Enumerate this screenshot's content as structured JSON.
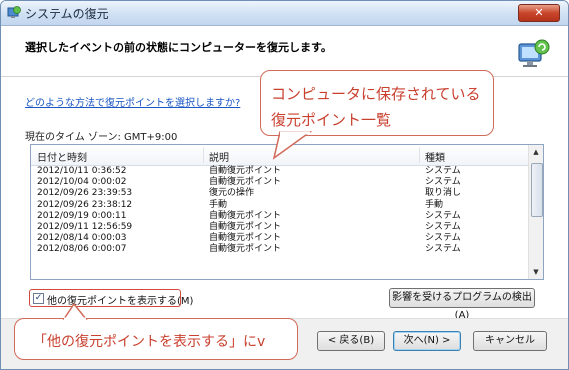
{
  "window": {
    "title": "システムの復元",
    "close_label": "✕"
  },
  "header": {
    "heading": "選択したイベントの前の状態にコンピューターを復元します。"
  },
  "body": {
    "link": "どのような方法で復元ポイントを選択しますか?",
    "timezone": "現在のタイム ゾーン: GMT+9:00"
  },
  "table": {
    "columns": [
      "日付と時刻",
      "説明",
      "種類"
    ],
    "rows": [
      [
        "2012/10/11 0:36:52",
        "自動復元ポイント",
        "システム"
      ],
      [
        "2012/10/04 0:00:02",
        "自動復元ポイント",
        "システム"
      ],
      [
        "2012/09/26 23:39:53",
        "復元の操作",
        "取り消し"
      ],
      [
        "2012/09/26 23:38:12",
        "手動",
        "手動"
      ],
      [
        "2012/09/19 0:00:11",
        "自動復元ポイント",
        "システム"
      ],
      [
        "2012/09/11 12:56:59",
        "自動復元ポイント",
        "システム"
      ],
      [
        "2012/08/14 0:00:03",
        "自動復元ポイント",
        "システム"
      ],
      [
        "2012/08/06 0:00:07",
        "自動復元ポイント",
        "システム"
      ]
    ]
  },
  "options": {
    "show_more_label": "他の復元ポイントを表示する(M)",
    "show_more_checked": true,
    "scan_button": "影響を受けるプログラムの検出(A)"
  },
  "footer": {
    "back": "< 戻る(B)",
    "next": "次へ(N) >",
    "cancel": "キャンセル"
  },
  "annotations": {
    "top_line1": "コンピュータに保存されている",
    "top_line2": "復元ポイント一覧",
    "bottom": "「他の復元ポイントを表示する」にv"
  },
  "colors": {
    "callout_border": "#d16a59",
    "callout_text": "#c9402f",
    "link": "#1a57c4"
  }
}
